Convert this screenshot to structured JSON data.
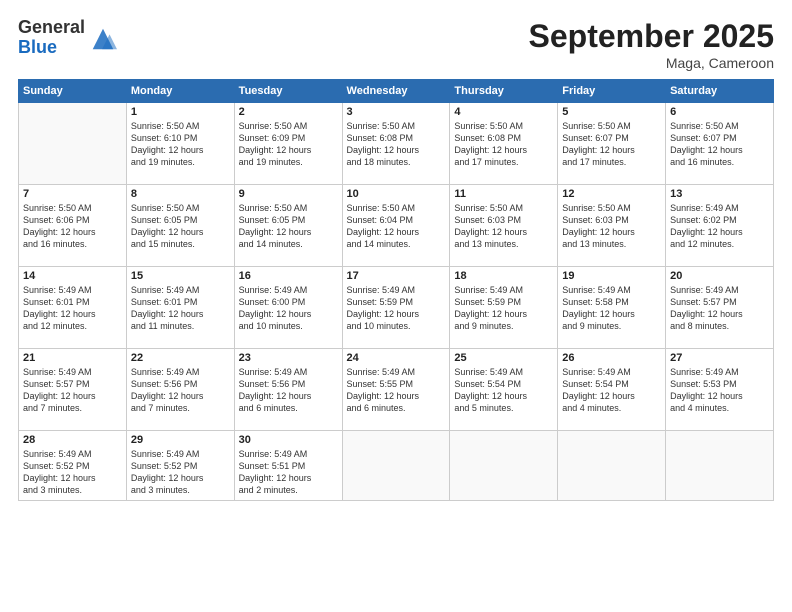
{
  "header": {
    "logo_general": "General",
    "logo_blue": "Blue",
    "month": "September 2025",
    "location": "Maga, Cameroon"
  },
  "weekdays": [
    "Sunday",
    "Monday",
    "Tuesday",
    "Wednesday",
    "Thursday",
    "Friday",
    "Saturday"
  ],
  "weeks": [
    [
      {
        "day": "",
        "info": ""
      },
      {
        "day": "1",
        "info": "Sunrise: 5:50 AM\nSunset: 6:10 PM\nDaylight: 12 hours\nand 19 minutes."
      },
      {
        "day": "2",
        "info": "Sunrise: 5:50 AM\nSunset: 6:09 PM\nDaylight: 12 hours\nand 19 minutes."
      },
      {
        "day": "3",
        "info": "Sunrise: 5:50 AM\nSunset: 6:08 PM\nDaylight: 12 hours\nand 18 minutes."
      },
      {
        "day": "4",
        "info": "Sunrise: 5:50 AM\nSunset: 6:08 PM\nDaylight: 12 hours\nand 17 minutes."
      },
      {
        "day": "5",
        "info": "Sunrise: 5:50 AM\nSunset: 6:07 PM\nDaylight: 12 hours\nand 17 minutes."
      },
      {
        "day": "6",
        "info": "Sunrise: 5:50 AM\nSunset: 6:07 PM\nDaylight: 12 hours\nand 16 minutes."
      }
    ],
    [
      {
        "day": "7",
        "info": "Sunrise: 5:50 AM\nSunset: 6:06 PM\nDaylight: 12 hours\nand 16 minutes."
      },
      {
        "day": "8",
        "info": "Sunrise: 5:50 AM\nSunset: 6:05 PM\nDaylight: 12 hours\nand 15 minutes."
      },
      {
        "day": "9",
        "info": "Sunrise: 5:50 AM\nSunset: 6:05 PM\nDaylight: 12 hours\nand 14 minutes."
      },
      {
        "day": "10",
        "info": "Sunrise: 5:50 AM\nSunset: 6:04 PM\nDaylight: 12 hours\nand 14 minutes."
      },
      {
        "day": "11",
        "info": "Sunrise: 5:50 AM\nSunset: 6:03 PM\nDaylight: 12 hours\nand 13 minutes."
      },
      {
        "day": "12",
        "info": "Sunrise: 5:50 AM\nSunset: 6:03 PM\nDaylight: 12 hours\nand 13 minutes."
      },
      {
        "day": "13",
        "info": "Sunrise: 5:49 AM\nSunset: 6:02 PM\nDaylight: 12 hours\nand 12 minutes."
      }
    ],
    [
      {
        "day": "14",
        "info": "Sunrise: 5:49 AM\nSunset: 6:01 PM\nDaylight: 12 hours\nand 12 minutes."
      },
      {
        "day": "15",
        "info": "Sunrise: 5:49 AM\nSunset: 6:01 PM\nDaylight: 12 hours\nand 11 minutes."
      },
      {
        "day": "16",
        "info": "Sunrise: 5:49 AM\nSunset: 6:00 PM\nDaylight: 12 hours\nand 10 minutes."
      },
      {
        "day": "17",
        "info": "Sunrise: 5:49 AM\nSunset: 5:59 PM\nDaylight: 12 hours\nand 10 minutes."
      },
      {
        "day": "18",
        "info": "Sunrise: 5:49 AM\nSunset: 5:59 PM\nDaylight: 12 hours\nand 9 minutes."
      },
      {
        "day": "19",
        "info": "Sunrise: 5:49 AM\nSunset: 5:58 PM\nDaylight: 12 hours\nand 9 minutes."
      },
      {
        "day": "20",
        "info": "Sunrise: 5:49 AM\nSunset: 5:57 PM\nDaylight: 12 hours\nand 8 minutes."
      }
    ],
    [
      {
        "day": "21",
        "info": "Sunrise: 5:49 AM\nSunset: 5:57 PM\nDaylight: 12 hours\nand 7 minutes."
      },
      {
        "day": "22",
        "info": "Sunrise: 5:49 AM\nSunset: 5:56 PM\nDaylight: 12 hours\nand 7 minutes."
      },
      {
        "day": "23",
        "info": "Sunrise: 5:49 AM\nSunset: 5:56 PM\nDaylight: 12 hours\nand 6 minutes."
      },
      {
        "day": "24",
        "info": "Sunrise: 5:49 AM\nSunset: 5:55 PM\nDaylight: 12 hours\nand 6 minutes."
      },
      {
        "day": "25",
        "info": "Sunrise: 5:49 AM\nSunset: 5:54 PM\nDaylight: 12 hours\nand 5 minutes."
      },
      {
        "day": "26",
        "info": "Sunrise: 5:49 AM\nSunset: 5:54 PM\nDaylight: 12 hours\nand 4 minutes."
      },
      {
        "day": "27",
        "info": "Sunrise: 5:49 AM\nSunset: 5:53 PM\nDaylight: 12 hours\nand 4 minutes."
      }
    ],
    [
      {
        "day": "28",
        "info": "Sunrise: 5:49 AM\nSunset: 5:52 PM\nDaylight: 12 hours\nand 3 minutes."
      },
      {
        "day": "29",
        "info": "Sunrise: 5:49 AM\nSunset: 5:52 PM\nDaylight: 12 hours\nand 3 minutes."
      },
      {
        "day": "30",
        "info": "Sunrise: 5:49 AM\nSunset: 5:51 PM\nDaylight: 12 hours\nand 2 minutes."
      },
      {
        "day": "",
        "info": ""
      },
      {
        "day": "",
        "info": ""
      },
      {
        "day": "",
        "info": ""
      },
      {
        "day": "",
        "info": ""
      }
    ]
  ]
}
